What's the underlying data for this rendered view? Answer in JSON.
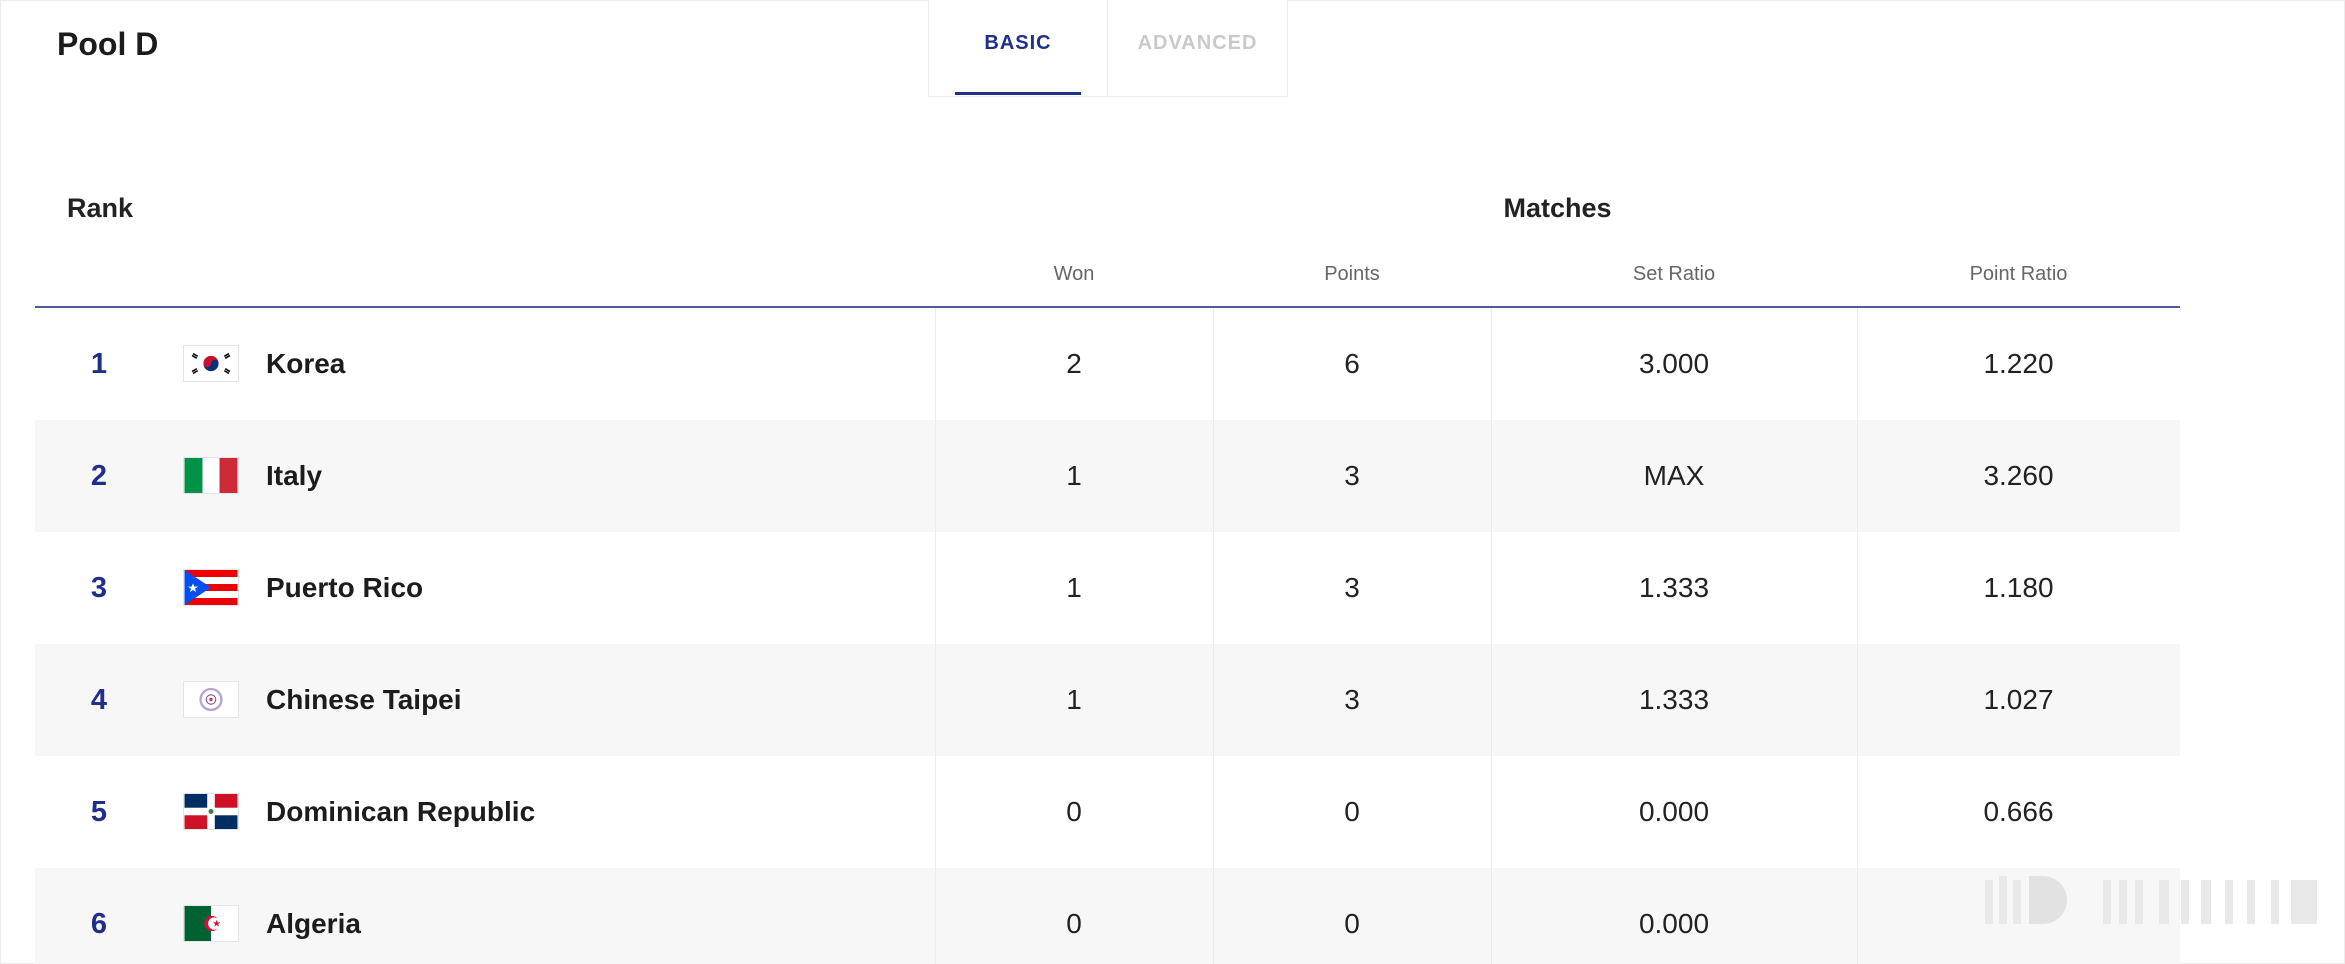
{
  "pool": {
    "title": "Pool D"
  },
  "tabs": [
    {
      "label": "BASIC",
      "active": true
    },
    {
      "label": "ADVANCED",
      "active": false
    }
  ],
  "table": {
    "rank_header": "Rank",
    "matches_header": "Matches",
    "columns": [
      "Won",
      "Points",
      "Set Ratio",
      "Point Ratio"
    ],
    "rows": [
      {
        "rank": "1",
        "flag": "korea-flag-icon",
        "team": "Korea",
        "won": "2",
        "points": "6",
        "set_ratio": "3.000",
        "point_ratio": "1.220"
      },
      {
        "rank": "2",
        "flag": "italy-flag-icon",
        "team": "Italy",
        "won": "1",
        "points": "3",
        "set_ratio": "MAX",
        "point_ratio": "3.260"
      },
      {
        "rank": "3",
        "flag": "puerto-rico-flag-icon",
        "team": "Puerto Rico",
        "won": "1",
        "points": "3",
        "set_ratio": "1.333",
        "point_ratio": "1.180"
      },
      {
        "rank": "4",
        "flag": "chinese-taipei-flag-icon",
        "team": "Chinese Taipei",
        "won": "1",
        "points": "3",
        "set_ratio": "1.333",
        "point_ratio": "1.027"
      },
      {
        "rank": "5",
        "flag": "dominican-republic-flag-icon",
        "team": "Dominican Republic",
        "won": "0",
        "points": "0",
        "set_ratio": "0.000",
        "point_ratio": "0.666"
      },
      {
        "rank": "6",
        "flag": "algeria-flag-icon",
        "team": "Algeria",
        "won": "0",
        "points": "0",
        "set_ratio": "0.000",
        "point_ratio": ""
      }
    ]
  },
  "colors": {
    "accent": "#1f2f8a",
    "header_rule": "#545a94",
    "alt_row": "#f7f7f7",
    "inactive_tab": "#c9c9c9"
  }
}
